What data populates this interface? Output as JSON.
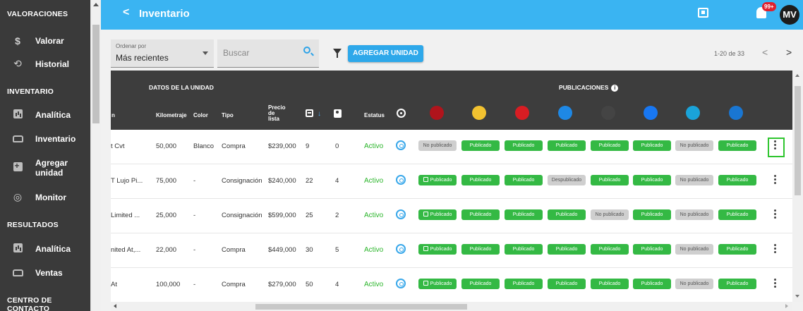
{
  "sidebar": {
    "sections": {
      "valoraciones": "VALORACIONES",
      "inventario": "INVENTARIO",
      "resultados": "RESULTADOS",
      "centro": "CENTRO DE CONTACTO"
    },
    "items": [
      {
        "label": "Valorar",
        "icon": "dollar-icon"
      },
      {
        "label": "Historial",
        "icon": "history-icon"
      },
      {
        "label": "Analítica",
        "icon": "chart-icon"
      },
      {
        "label": "Inventario",
        "icon": "car-icon"
      },
      {
        "label": "Agregar unidad",
        "icon": "add-box-icon"
      },
      {
        "label": "Monitor",
        "icon": "monitor-signal-icon"
      },
      {
        "label": "Analítica",
        "icon": "chart-icon"
      },
      {
        "label": "Ventas",
        "icon": "car-icon"
      }
    ]
  },
  "topbar": {
    "back": "<",
    "title": "Inventario",
    "notifications_badge": "99+",
    "avatar": "MV",
    "color": "#3ab4f2"
  },
  "toolbar": {
    "order_caption": "Ordenar por",
    "order_value": "Más recientes",
    "search_placeholder": "Buscar",
    "add_button": "AGREGAR UNIDAD",
    "pager_text": "1-20 de 33",
    "prev": "<",
    "next": ">"
  },
  "table": {
    "group_unit": "DATOS DE LA UNIDAD",
    "group_publications": "PUBLICACIONES",
    "info_glyph": "i",
    "sort_arrow": "↓",
    "headers": {
      "name_partial": "n",
      "km": "Kilometraje",
      "color": "Color",
      "tipo": "Tipo",
      "precio_1": "Precio",
      "precio_2": "de",
      "precio_3": "lista",
      "estatus": "Estatus"
    },
    "rows": [
      {
        "name": "t Cvt",
        "km": "50,000",
        "color": "Blanco",
        "tipo": "Compra",
        "precio": "$239,000",
        "d": "9",
        "p": "0",
        "estatus": "Activo",
        "pubs": [
          "No publicado",
          "Publicado",
          "Publicado",
          "Publicado",
          "Publicado",
          "Publicado",
          "No publicado",
          "Publicado"
        ]
      },
      {
        "name": "T Lujo Pi...",
        "km": "75,000",
        "color": "-",
        "tipo": "Consignación",
        "precio": "$240,000",
        "d": "22",
        "p": "4",
        "estatus": "Activo",
        "pubs": [
          "Publicado",
          "Publicado",
          "Publicado",
          "Despublicado",
          "Publicado",
          "Publicado",
          "No publicado",
          "Publicado"
        ]
      },
      {
        "name": "Limited ...",
        "km": "25,000",
        "color": "-",
        "tipo": "Consignación",
        "precio": "$599,000",
        "d": "25",
        "p": "2",
        "estatus": "Activo",
        "pubs": [
          "Publicado",
          "Publicado",
          "Publicado",
          "Publicado",
          "No publicado",
          "Publicado",
          "No publicado",
          "Publicado"
        ]
      },
      {
        "name": "nited At,...",
        "km": "22,000",
        "color": "-",
        "tipo": "Compra",
        "precio": "$449,000",
        "d": "30",
        "p": "5",
        "estatus": "Activo",
        "pubs": [
          "Publicado",
          "Publicado",
          "Publicado",
          "Publicado",
          "Publicado",
          "Publicado",
          "No publicado",
          "Publicado"
        ]
      },
      {
        "name": "At",
        "km": "100,000",
        "color": "-",
        "tipo": "Compra",
        "precio": "$279,000",
        "d": "50",
        "p": "4",
        "estatus": "Activo",
        "pubs": [
          "Publicado",
          "Publicado",
          "Publicado",
          "Publicado",
          "Publicado",
          "Publicado",
          "No publicado",
          "Publicado"
        ]
      }
    ],
    "platforms": [
      {
        "name": "platform-1-icon",
        "color": "#b0141c"
      },
      {
        "name": "platform-2-icon",
        "color": "#f2c230"
      },
      {
        "name": "platform-3-icon",
        "color": "#d81d23"
      },
      {
        "name": "platform-4-icon",
        "color": "#1e88e5"
      },
      {
        "name": "platform-5-icon",
        "color": "#444444"
      },
      {
        "name": "facebook-icon",
        "color": "#1877f2"
      },
      {
        "name": "platform-7-icon",
        "color": "#1aa3d9"
      },
      {
        "name": "platform-8-icon",
        "color": "#1976d2"
      }
    ],
    "colors": {
      "published": "#34b944",
      "unpublished": "#cfcfcf",
      "status_active": "#2bb52b"
    }
  }
}
